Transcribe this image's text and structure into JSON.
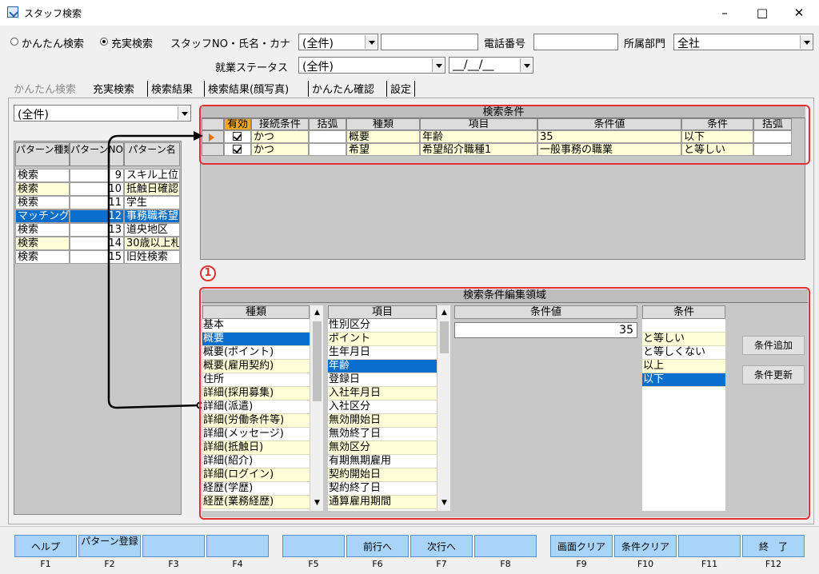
{
  "window": {
    "title": "スタッフ検索",
    "minimize": "–",
    "maximize": "□",
    "close": "✕"
  },
  "search": {
    "mode_simple": "かんたん検索",
    "mode_full": "充実検索",
    "staff_label": "スタッフNO・氏名・カナ",
    "staff_combo": "(全件)",
    "staff_value": "",
    "phone_label": "電話番号",
    "phone_value": "",
    "dept_label": "所属部門",
    "dept_value": "全社",
    "status_label": "就業ステータス",
    "status_value": "(全件)",
    "date_value": "__/__/__"
  },
  "tabs": [
    "かんたん検索",
    "充実検索",
    "検索結果",
    "検索結果(顔写真)",
    "かんたん確認",
    "設定"
  ],
  "pattern": {
    "combo": "(全件)",
    "headers": [
      "パターン種類",
      "パターンNO",
      "パターン名"
    ],
    "rows": [
      {
        "type": "検索",
        "no": "9",
        "name": "スキル上位"
      },
      {
        "type": "検索",
        "no": "10",
        "name": "抵触日確認"
      },
      {
        "type": "検索",
        "no": "11",
        "name": "学生"
      },
      {
        "type": "マッチング",
        "no": "12",
        "name": "事務職希望"
      },
      {
        "type": "検索",
        "no": "13",
        "name": "道央地区"
      },
      {
        "type": "検索",
        "no": "14",
        "name": "30歳以上札"
      },
      {
        "type": "検索",
        "no": "15",
        "name": "旧姓検索"
      }
    ]
  },
  "conditions": {
    "title": "検索条件",
    "headers": [
      "有効",
      "接続条件",
      "括弧",
      "種類",
      "項目",
      "条件値",
      "条件",
      "括弧"
    ],
    "rows": [
      {
        "conn": "かつ",
        "paren1": "",
        "kind": "概要",
        "item": "年齢",
        "value": "35",
        "cond": "以下",
        "paren2": ""
      },
      {
        "conn": "かつ",
        "paren1": "",
        "kind": "希望",
        "item": "希望紹介職種1",
        "value": "一般事務の職業",
        "cond": "と等しい",
        "paren2": ""
      }
    ]
  },
  "annotation": "1",
  "edit": {
    "title": "検索条件編集領域",
    "kind_header": "種類",
    "item_header": "項目",
    "value_header": "条件値",
    "cond_header": "条件",
    "kinds": [
      "基本",
      "概要",
      "概要(ポイント)",
      "概要(雇用契約)",
      "住所",
      "詳細(採用募集)",
      "詳細(派遣)",
      "詳細(労働条件等)",
      "詳細(メッセージ)",
      "詳細(抵触日)",
      "詳細(紹介)",
      "詳細(ログイン)",
      "経歴(学歴)",
      "経歴(業務経歴)"
    ],
    "items": [
      "性別区分",
      "ポイント",
      "生年月日",
      "年齢",
      "登録日",
      "入社年月日",
      "入社区分",
      "無効開始日",
      "無効終了日",
      "無効区分",
      "有期無期雇用",
      "契約開始日",
      "契約終了日",
      "通算雇用期間"
    ],
    "value": "35",
    "conds": [
      "",
      "と等しい",
      "と等しくない",
      "以上",
      "以下"
    ],
    "add_button": "条件追加",
    "update_button": "条件更新"
  },
  "fkeys": [
    {
      "label": "ヘルプ",
      "key": "F1"
    },
    {
      "label": "パターン登録",
      "key": "F2"
    },
    {
      "label": "",
      "key": "F3"
    },
    {
      "label": "",
      "key": "F4"
    },
    {
      "label": "",
      "key": "F5"
    },
    {
      "label": "前行へ",
      "key": "F6"
    },
    {
      "label": "次行へ",
      "key": "F7"
    },
    {
      "label": "",
      "key": "F8"
    },
    {
      "label": "画面クリア",
      "key": "F9"
    },
    {
      "label": "条件クリア",
      "key": "F10"
    },
    {
      "label": "",
      "key": "F11"
    },
    {
      "label": "終　了",
      "key": "F12"
    }
  ],
  "colors": {
    "accent": "#e23030",
    "selected": "#0a6fcc",
    "highlight": "#ffffd8",
    "fkey": "#a8d4f8",
    "header_active": "#f6a623"
  }
}
